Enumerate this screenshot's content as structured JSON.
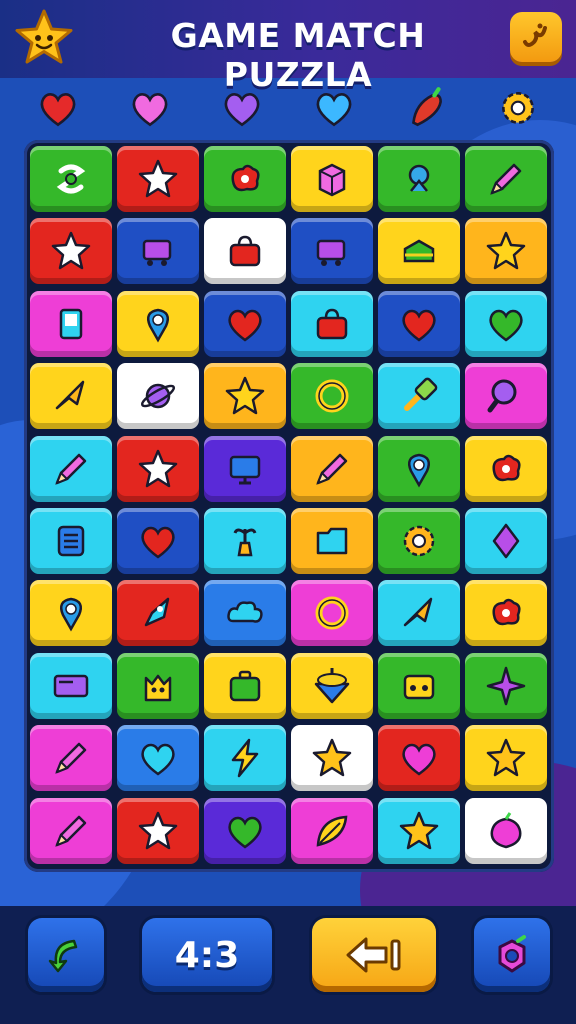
{
  "header": {
    "title": "GAME MATCH PUZZLA",
    "logo_icon": "smiling-star-icon",
    "menu_icon": "squiggle-icon"
  },
  "goals": [
    {
      "icon": "heart",
      "color": "#e52a2a"
    },
    {
      "icon": "heart",
      "color": "#f06ae0"
    },
    {
      "icon": "heart",
      "color": "#a45ef0"
    },
    {
      "icon": "heart",
      "color": "#3cb8ff"
    },
    {
      "icon": "pepper",
      "color": "#e03a2a"
    },
    {
      "icon": "gear",
      "color": "#ffc21a"
    }
  ],
  "board": {
    "columns": 6,
    "rows": 10,
    "tiles": [
      [
        {
          "bg": "#35b82a",
          "icon": "swirl"
        },
        {
          "bg": "#e3261f",
          "icon": "star"
        },
        {
          "bg": "#35b82a",
          "icon": "blob"
        },
        {
          "bg": "#ffd41c",
          "icon": "box"
        },
        {
          "bg": "#35b82a",
          "icon": "bulb"
        },
        {
          "bg": "#35b82a",
          "icon": "pencil"
        }
      ],
      [
        {
          "bg": "#e3261f",
          "icon": "star"
        },
        {
          "bg": "#1f4fc4",
          "icon": "cart"
        },
        {
          "bg": "#ffffff",
          "icon": "bag"
        },
        {
          "bg": "#1f4fc4",
          "icon": "cart"
        },
        {
          "bg": "#ffd41c",
          "icon": "cake"
        },
        {
          "bg": "#ffb51c",
          "icon": "star"
        }
      ],
      [
        {
          "bg": "#ee3ed6",
          "icon": "phone"
        },
        {
          "bg": "#ffd41c",
          "icon": "pin"
        },
        {
          "bg": "#1f4fc4",
          "icon": "heart"
        },
        {
          "bg": "#2fd3f0",
          "icon": "bag"
        },
        {
          "bg": "#1f4fc4",
          "icon": "heart"
        },
        {
          "bg": "#2fd3f0",
          "icon": "heart"
        }
      ],
      [
        {
          "bg": "#ffd41c",
          "icon": "arrow"
        },
        {
          "bg": "#ffffff",
          "icon": "planet"
        },
        {
          "bg": "#ffb51c",
          "icon": "star"
        },
        {
          "bg": "#35b82a",
          "icon": "ring"
        },
        {
          "bg": "#2fd3f0",
          "icon": "brush"
        },
        {
          "bg": "#ee3ed6",
          "icon": "magnifier"
        }
      ],
      [
        {
          "bg": "#2fd3f0",
          "icon": "pencil"
        },
        {
          "bg": "#e3261f",
          "icon": "star"
        },
        {
          "bg": "#5a2ad8",
          "icon": "screen"
        },
        {
          "bg": "#ffb51c",
          "icon": "pencil"
        },
        {
          "bg": "#35b82a",
          "icon": "pin"
        },
        {
          "bg": "#ffd41c",
          "icon": "blob"
        }
      ],
      [
        {
          "bg": "#2fd3f0",
          "icon": "list"
        },
        {
          "bg": "#1f4fc4",
          "icon": "heart"
        },
        {
          "bg": "#2fd3f0",
          "icon": "plant"
        },
        {
          "bg": "#ffb51c",
          "icon": "folder"
        },
        {
          "bg": "#35b82a",
          "icon": "gear"
        },
        {
          "bg": "#2fd3f0",
          "icon": "diamond"
        }
      ],
      [
        {
          "bg": "#ffd41c",
          "icon": "pin"
        },
        {
          "bg": "#e3261f",
          "icon": "rocket"
        },
        {
          "bg": "#2a7ce8",
          "icon": "cloud"
        },
        {
          "bg": "#ee3ed6",
          "icon": "ring"
        },
        {
          "bg": "#2fd3f0",
          "icon": "arrow"
        },
        {
          "bg": "#ffd41c",
          "icon": "blob"
        }
      ],
      [
        {
          "bg": "#2fd3f0",
          "icon": "card"
        },
        {
          "bg": "#35b82a",
          "icon": "cat"
        },
        {
          "bg": "#ffd41c",
          "icon": "briefcase"
        },
        {
          "bg": "#ffd41c",
          "icon": "top"
        },
        {
          "bg": "#35b82a",
          "icon": "radio"
        },
        {
          "bg": "#35b82a",
          "icon": "sparkle"
        }
      ],
      [
        {
          "bg": "#ee3ed6",
          "icon": "pencil"
        },
        {
          "bg": "#2a7ce8",
          "icon": "heart"
        },
        {
          "bg": "#2fd3f0",
          "icon": "bolt"
        },
        {
          "bg": "#ffffff",
          "icon": "star"
        },
        {
          "bg": "#e3261f",
          "icon": "heart"
        },
        {
          "bg": "#ffd41c",
          "icon": "star"
        }
      ],
      [
        {
          "bg": "#ee3ed6",
          "icon": "pencil"
        },
        {
          "bg": "#e3261f",
          "icon": "star"
        },
        {
          "bg": "#5a2ad8",
          "icon": "heart"
        },
        {
          "bg": "#ee3ed6",
          "icon": "leaf"
        },
        {
          "bg": "#2fd3f0",
          "icon": "star"
        },
        {
          "bg": "#ffffff",
          "icon": "onion"
        }
      ]
    ]
  },
  "controls": {
    "back_icon": "green-back-arrow-icon",
    "ratio": "4:3",
    "undo_icon": "return-arrow-icon",
    "shuffle_icon": "ring-icon"
  }
}
